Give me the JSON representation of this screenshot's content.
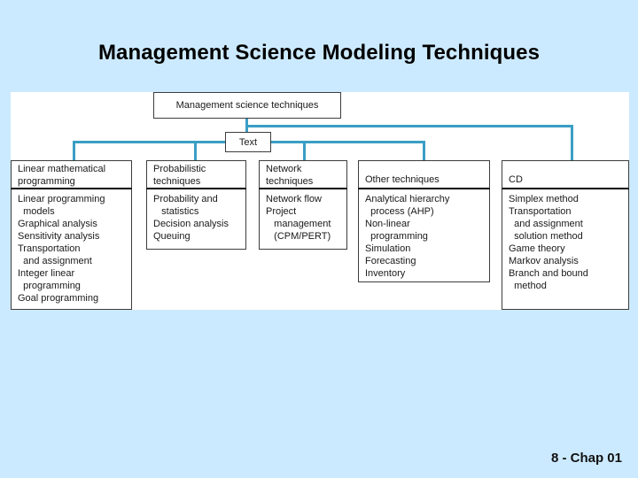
{
  "slide": {
    "title": "Management Science Modeling Techniques",
    "footer": "8 - Chap 01",
    "background_color": "#cceaff",
    "panel_color": "#ffffff",
    "connector_color": "#3a9ec4",
    "box_border_color": "#3d3d3d"
  },
  "diagram": {
    "root_label": "Management science techniques",
    "text_node_label": "Text",
    "columns": [
      {
        "header": "Linear mathematical\nprogramming",
        "items": [
          "Linear programming\n  models",
          "Graphical analysis",
          "Sensitivity analysis",
          "Transportation\n  and assignment",
          "Integer linear\n  programming",
          "Goal programming"
        ]
      },
      {
        "header": "Probabilistic\ntechniques",
        "items": [
          "Probability and\n   statistics",
          "Decision analysis",
          "Queuing"
        ]
      },
      {
        "header": "Network\ntechniques",
        "items": [
          "Network flow",
          "Project\n   management\n   (CPM/PERT)"
        ]
      },
      {
        "header": "Other techniques",
        "items": [
          "Analytical hierarchy\n  process (AHP)",
          "Non-linear\n  programming",
          "Simulation",
          "Forecasting",
          "Inventory"
        ]
      },
      {
        "header": "CD",
        "items": [
          "Simplex method",
          "Transportation\n  and assignment\n  solution method",
          "Game theory",
          "Markov analysis",
          "Branch and bound\n  method"
        ]
      }
    ]
  }
}
